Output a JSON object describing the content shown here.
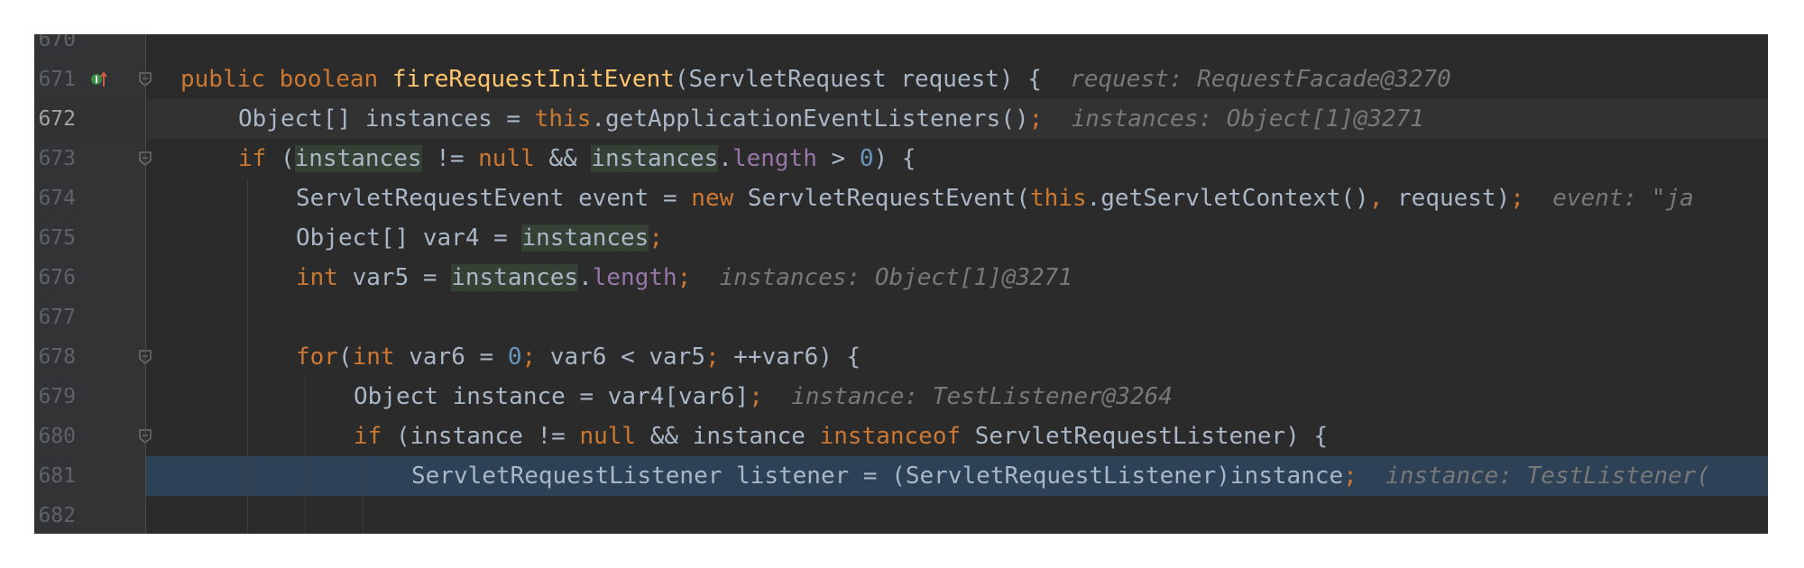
{
  "editor": {
    "lines": [
      {
        "number": "670",
        "indent": 2,
        "segments": []
      },
      {
        "number": "671",
        "indent": 2,
        "segments": [
          {
            "t": "public ",
            "c": "kw"
          },
          {
            "t": "boolean ",
            "c": "kw"
          },
          {
            "t": "fireRequestInitEvent",
            "c": "fn"
          },
          {
            "t": "(ServletRequest request) {",
            "c": ""
          },
          {
            "t": "  request: RequestFacade@3270",
            "c": "hint"
          }
        ]
      },
      {
        "number": "672",
        "indent": 3,
        "segments": [
          {
            "t": "Object[] ",
            "c": ""
          },
          {
            "t": "instances",
            "c": ""
          },
          {
            "t": " = ",
            "c": ""
          },
          {
            "t": "this",
            "c": "kw"
          },
          {
            "t": ".getApplicationEventListeners()",
            "c": ""
          },
          {
            "t": ";",
            "c": "kw"
          },
          {
            "t": "  instances: Object[1]@3271",
            "c": "hint"
          }
        ]
      },
      {
        "number": "673",
        "indent": 3,
        "segments": [
          {
            "t": "if ",
            "c": "kw"
          },
          {
            "t": "(",
            "c": ""
          },
          {
            "t": "instances",
            "c": "hl"
          },
          {
            "t": " != ",
            "c": ""
          },
          {
            "t": "null",
            "c": "kw"
          },
          {
            "t": " && ",
            "c": ""
          },
          {
            "t": "instances",
            "c": "hl"
          },
          {
            "t": ".",
            "c": ""
          },
          {
            "t": "length",
            "c": "fld"
          },
          {
            "t": " > ",
            "c": ""
          },
          {
            "t": "0",
            "c": "num"
          },
          {
            "t": ") {",
            "c": ""
          }
        ]
      },
      {
        "number": "674",
        "indent": 4,
        "segments": [
          {
            "t": "ServletRequestEvent event = ",
            "c": ""
          },
          {
            "t": "new ",
            "c": "kw"
          },
          {
            "t": "ServletRequestEvent(",
            "c": ""
          },
          {
            "t": "this",
            "c": "kw"
          },
          {
            "t": ".getServletContext()",
            "c": ""
          },
          {
            "t": ", ",
            "c": "kw"
          },
          {
            "t": "request)",
            "c": ""
          },
          {
            "t": ";",
            "c": "kw"
          },
          {
            "t": "  event: \"ja",
            "c": "hint"
          }
        ]
      },
      {
        "number": "675",
        "indent": 4,
        "segments": [
          {
            "t": "Object[] var4 = ",
            "c": ""
          },
          {
            "t": "instances",
            "c": "hl"
          },
          {
            "t": ";",
            "c": "kw"
          }
        ]
      },
      {
        "number": "676",
        "indent": 4,
        "segments": [
          {
            "t": "int ",
            "c": "kw"
          },
          {
            "t": "var5 = ",
            "c": ""
          },
          {
            "t": "instances",
            "c": "hl"
          },
          {
            "t": ".",
            "c": ""
          },
          {
            "t": "length",
            "c": "fld"
          },
          {
            "t": ";",
            "c": "kw"
          },
          {
            "t": "  instances: Object[1]@3271",
            "c": "hint"
          }
        ]
      },
      {
        "number": "677",
        "indent": 4,
        "segments": []
      },
      {
        "number": "678",
        "indent": 4,
        "segments": [
          {
            "t": "for",
            "c": "kw"
          },
          {
            "t": "(",
            "c": ""
          },
          {
            "t": "int ",
            "c": "kw"
          },
          {
            "t": "var6 = ",
            "c": ""
          },
          {
            "t": "0",
            "c": "num"
          },
          {
            "t": "; ",
            "c": "kw"
          },
          {
            "t": "var6 < var5",
            "c": ""
          },
          {
            "t": "; ",
            "c": "kw"
          },
          {
            "t": "++var6) {",
            "c": ""
          }
        ]
      },
      {
        "number": "679",
        "indent": 5,
        "segments": [
          {
            "t": "Object instance = var4[var6]",
            "c": ""
          },
          {
            "t": ";",
            "c": "kw"
          },
          {
            "t": "  instance: TestListener@3264",
            "c": "hint"
          }
        ]
      },
      {
        "number": "680",
        "indent": 5,
        "segments": [
          {
            "t": "if ",
            "c": "kw"
          },
          {
            "t": "(instance != ",
            "c": ""
          },
          {
            "t": "null",
            "c": "kw"
          },
          {
            "t": " && instance ",
            "c": ""
          },
          {
            "t": "instanceof ",
            "c": "kw"
          },
          {
            "t": "ServletRequestListener) {",
            "c": ""
          }
        ]
      },
      {
        "number": "681",
        "indent": 6,
        "segments": [
          {
            "t": "ServletRequestListener listener = (ServletRequestListener)instance",
            "c": ""
          },
          {
            "t": ";",
            "c": "kw"
          },
          {
            "t": "  instance: TestListener(",
            "c": "hint"
          }
        ]
      },
      {
        "number": "682",
        "indent": 6,
        "segments": []
      }
    ],
    "caret_line": "672",
    "execution_line": "681"
  },
  "colors": {
    "background": "#2b2b2b",
    "gutter": "#313335",
    "keyword": "#cc7832",
    "method": "#ffc66d",
    "field": "#9876aa",
    "number": "#6897bb",
    "text": "#a9b7c6",
    "inlay_hint": "#787878",
    "execution_highlight": "#2d4157",
    "usage_highlight": "#344134"
  },
  "icons": [
    "implements-method-gutter-icon",
    "fold-icon"
  ]
}
